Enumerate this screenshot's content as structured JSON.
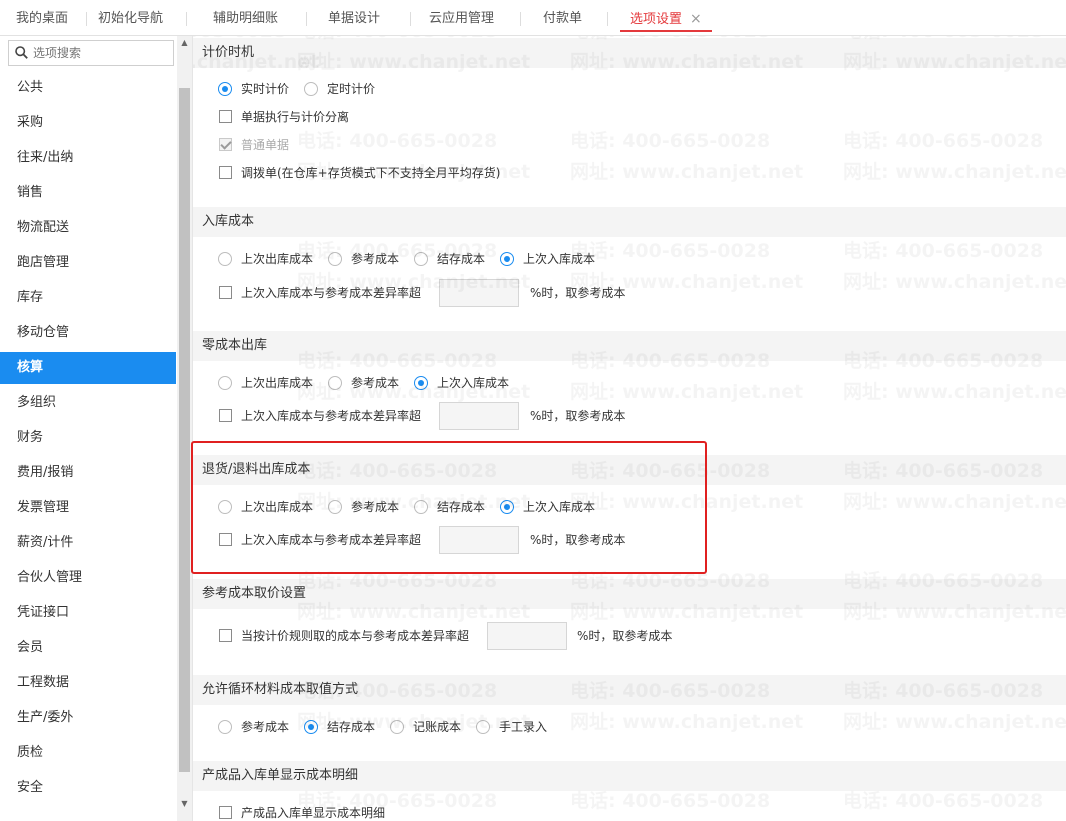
{
  "tabs": [
    {
      "label": "我的桌面"
    },
    {
      "label": "初始化导航"
    },
    {
      "label": "辅助明细账"
    },
    {
      "label": "单据设计"
    },
    {
      "label": "云应用管理"
    },
    {
      "label": "付款单"
    },
    {
      "label": "选项设置",
      "active": true,
      "close": "×"
    }
  ],
  "sidebar": {
    "search_placeholder": "选项搜索",
    "items": [
      "公共",
      "采购",
      "往来/出纳",
      "销售",
      "物流配送",
      "跑店管理",
      "库存",
      "移动仓管",
      "核算",
      "多组织",
      "财务",
      "费用/报销",
      "发票管理",
      "薪资/计件",
      "合伙人管理",
      "凭证接口",
      "会员",
      "工程数据",
      "生产/委外",
      "质检",
      "安全"
    ],
    "active_item": "核算"
  },
  "sections": {
    "pricing_timing": {
      "title": "计价时机",
      "realtime": "实时计价",
      "scheduled": "定时计价",
      "separate": "单据执行与计价分离",
      "normal_doc": "普通单据",
      "transfer_doc": "调拨单(在仓库+存货模式下不支持全月平均存货)"
    },
    "inbound_cost": {
      "title": "入库成本",
      "opt1": "上次出库成本",
      "opt2": "参考成本",
      "opt3": "结存成本",
      "opt4": "上次入库成本",
      "diff_label": "上次入库成本与参考成本差异率超",
      "diff_suffix": "%时，取参考成本"
    },
    "zero_cost_outbound": {
      "title": "零成本出库",
      "opt1": "上次出库成本",
      "opt2": "参考成本",
      "opt3": "上次入库成本",
      "diff_label": "上次入库成本与参考成本差异率超",
      "diff_suffix": "%时，取参考成本"
    },
    "return_cost": {
      "title": "退货/退料出库成本",
      "opt1": "上次出库成本",
      "opt2": "参考成本",
      "opt3": "结存成本",
      "opt4": "上次入库成本",
      "diff_label": "上次入库成本与参考成本差异率超",
      "diff_suffix": "%时，取参考成本"
    },
    "reference_cost": {
      "title": "参考成本取价设置",
      "diff_label": "当按计价规则取的成本与参考成本差异率超",
      "diff_suffix": "%时，取参考成本"
    },
    "cyclic_material": {
      "title": "允许循环材料成本取值方式",
      "opt1": "参考成本",
      "opt2": "结存成本",
      "opt3": "记账成本",
      "opt4": "手工录入"
    },
    "product_inbound": {
      "title": "产成品入库单显示成本明细",
      "show_detail": "产成品入库单显示成本明细"
    }
  },
  "watermark": {
    "phone": "电话: 400-665-0028",
    "site": "网址: www.chanjet.net"
  },
  "colors": {
    "accent": "#1a8cf0",
    "active_tab": "#e4393c",
    "highlight": "#e02020"
  }
}
